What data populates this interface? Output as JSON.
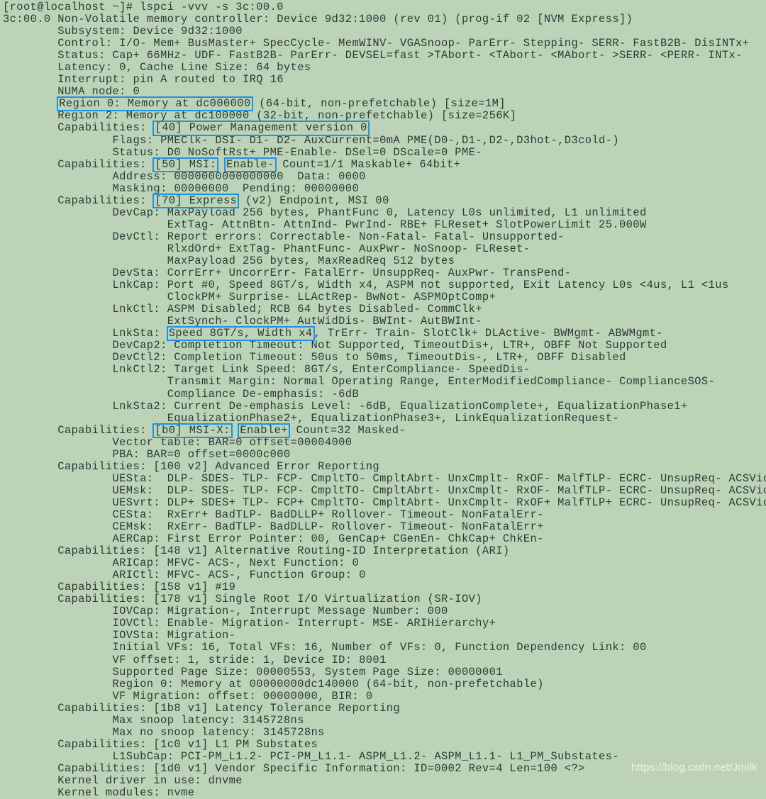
{
  "terminal": {
    "background_color": "#bdd3b8",
    "text_color": "#2b3a33",
    "highlight_color": "#1e93e6",
    "prompt": "[root@localhost ~]# ",
    "command": "lspci -vvv -s 3c:00.0",
    "watermark": "https://blog.csdn.net/Jmilk",
    "lines": [
      {
        "id": "l00",
        "segments": [
          {
            "text": "[root@localhost ~]# lspci -vvv -s 3c:00.0"
          }
        ]
      },
      {
        "id": "l01",
        "segments": [
          {
            "text": "3c:00.0 Non-Volatile memory controller: Device 9d32:1000 (rev 01) (prog-if 02 [NVM Express])"
          }
        ]
      },
      {
        "id": "l02",
        "segments": [
          {
            "text": "        Subsystem: Device 9d32:1000"
          }
        ]
      },
      {
        "id": "l03",
        "segments": [
          {
            "text": "        Control: I/O- Mem+ BusMaster+ SpecCycle- MemWINV- VGASnoop- ParErr- Stepping- SERR- FastB2B- DisINTx+"
          }
        ]
      },
      {
        "id": "l04",
        "segments": [
          {
            "text": "        Status: Cap+ 66MHz- UDF- FastB2B- ParErr- DEVSEL=fast >TAbort- <TAbort- <MAbort- >SERR- <PERR- INTx-"
          }
        ]
      },
      {
        "id": "l05",
        "segments": [
          {
            "text": "        Latency: 0, Cache Line Size: 64 bytes"
          }
        ]
      },
      {
        "id": "l06",
        "segments": [
          {
            "text": "        Interrupt: pin A routed to IRQ 16"
          }
        ]
      },
      {
        "id": "l07",
        "segments": [
          {
            "text": "        NUMA node: 0"
          }
        ]
      },
      {
        "id": "l08",
        "segments": [
          {
            "text": "        "
          },
          {
            "text": "Region 0: Memory at dc000000",
            "highlight": true
          },
          {
            "text": " (64-bit, non-prefetchable) [size=1M]"
          }
        ]
      },
      {
        "id": "l09",
        "segments": [
          {
            "text": "        Region 2: Memory at dc100000 (32-bit, non-prefetchable) [size=256K]"
          }
        ]
      },
      {
        "id": "l10",
        "segments": [
          {
            "text": "        Capabilities: "
          },
          {
            "text": "[40] Power Management version 0",
            "highlight": true
          }
        ]
      },
      {
        "id": "l11",
        "segments": [
          {
            "text": "                Flags: PMEClk- DSI- D1- D2- AuxCurrent=0mA PME(D0-,D1-,D2-,D3hot-,D3cold-)"
          }
        ]
      },
      {
        "id": "l12",
        "segments": [
          {
            "text": "                Status: D0 NoSoftRst+ PME-Enable- DSel=0 DScale=0 PME-"
          }
        ]
      },
      {
        "id": "l13",
        "segments": [
          {
            "text": "        Capabilities: "
          },
          {
            "text": "[50] MSI:",
            "highlight": true
          },
          {
            "text": " "
          },
          {
            "text": "Enable-",
            "highlight": true
          },
          {
            "text": " Count=1/1 Maskable+ 64bit+"
          }
        ]
      },
      {
        "id": "l14",
        "segments": [
          {
            "text": "                Address: 0000000000000000  Data: 0000"
          }
        ]
      },
      {
        "id": "l15",
        "segments": [
          {
            "text": "                Masking: 00000000  Pending: 00000000"
          }
        ]
      },
      {
        "id": "l16",
        "segments": [
          {
            "text": "        Capabilities: "
          },
          {
            "text": "[70] Express",
            "highlight": true
          },
          {
            "text": " (v2) Endpoint, MSI 00"
          }
        ]
      },
      {
        "id": "l17",
        "segments": [
          {
            "text": "                DevCap: MaxPayload 256 bytes, PhantFunc 0, Latency L0s unlimited, L1 unlimited"
          }
        ]
      },
      {
        "id": "l18",
        "segments": [
          {
            "text": "                        ExtTag- AttnBtn- AttnInd- PwrInd- RBE+ FLReset+ SlotPowerLimit 25.000W"
          }
        ]
      },
      {
        "id": "l19",
        "segments": [
          {
            "text": "                DevCtl: Report errors: Correctable- Non-Fatal- Fatal- Unsupported-"
          }
        ]
      },
      {
        "id": "l20",
        "segments": [
          {
            "text": "                        RlxdOrd+ ExtTag- PhantFunc- AuxPwr- NoSnoop- FLReset-"
          }
        ]
      },
      {
        "id": "l21",
        "segments": [
          {
            "text": "                        MaxPayload 256 bytes, MaxReadReq 512 bytes"
          }
        ]
      },
      {
        "id": "l22",
        "segments": [
          {
            "text": "                DevSta: CorrErr+ UncorrErr- FatalErr- UnsuppReq- AuxPwr- TransPend-"
          }
        ]
      },
      {
        "id": "l23",
        "segments": [
          {
            "text": "                LnkCap: Port #0, Speed 8GT/s, Width x4, ASPM not supported, Exit Latency L0s <4us, L1 <1us"
          }
        ]
      },
      {
        "id": "l24",
        "segments": [
          {
            "text": "                        ClockPM+ Surprise- LLActRep- BwNot- ASPMOptComp+"
          }
        ]
      },
      {
        "id": "l25",
        "segments": [
          {
            "text": "                LnkCtl: ASPM Disabled; RCB 64 bytes Disabled- CommClk+"
          }
        ]
      },
      {
        "id": "l26",
        "segments": [
          {
            "text": "                        ExtSynch- ClockPM+ AutWidDis- BWInt- AutBWInt-"
          }
        ]
      },
      {
        "id": "l27",
        "segments": [
          {
            "text": "                LnkSta: "
          },
          {
            "text": "Speed 8GT/s, Width x4",
            "highlight": true
          },
          {
            "text": ", TrErr- Train- SlotClk+ DLActive- BWMgmt- ABWMgmt-"
          }
        ]
      },
      {
        "id": "l28",
        "segments": [
          {
            "text": "                DevCap2: Completion Timeout: Not Supported, TimeoutDis+, LTR+, OBFF Not Supported"
          }
        ]
      },
      {
        "id": "l29",
        "segments": [
          {
            "text": "                DevCtl2: Completion Timeout: 50us to 50ms, TimeoutDis-, LTR+, OBFF Disabled"
          }
        ]
      },
      {
        "id": "l30",
        "segments": [
          {
            "text": "                LnkCtl2: Target Link Speed: 8GT/s, EnterCompliance- SpeedDis-"
          }
        ]
      },
      {
        "id": "l31",
        "segments": [
          {
            "text": "                        Transmit Margin: Normal Operating Range, EnterModifiedCompliance- ComplianceSOS-"
          }
        ]
      },
      {
        "id": "l32",
        "segments": [
          {
            "text": "                        Compliance De-emphasis: -6dB"
          }
        ]
      },
      {
        "id": "l33",
        "segments": [
          {
            "text": "                LnkSta2: Current De-emphasis Level: -6dB, EqualizationComplete+, EqualizationPhase1+"
          }
        ]
      },
      {
        "id": "l34",
        "segments": [
          {
            "text": "                        EqualizationPhase2+, EqualizationPhase3+, LinkEqualizationRequest-"
          }
        ]
      },
      {
        "id": "l35",
        "segments": [
          {
            "text": "        Capabilities: "
          },
          {
            "text": "[b0] MSI-X:",
            "highlight": true
          },
          {
            "text": " "
          },
          {
            "text": "Enable+",
            "highlight": true
          },
          {
            "text": " Count=32 Masked-"
          }
        ]
      },
      {
        "id": "l36",
        "segments": [
          {
            "text": "                Vector table: BAR=0 offset=00004000"
          }
        ]
      },
      {
        "id": "l37",
        "segments": [
          {
            "text": "                PBA: BAR=0 offset=0000c000"
          }
        ]
      },
      {
        "id": "l38",
        "segments": [
          {
            "text": "        Capabilities: [100 v2] Advanced Error Reporting"
          }
        ]
      },
      {
        "id": "l39",
        "segments": [
          {
            "text": "                UESta:  DLP- SDES- TLP- FCP- CmpltTO- CmpltAbrt- UnxCmplt- RxOF- MalfTLP- ECRC- UnsupReq- ACSViol-"
          }
        ]
      },
      {
        "id": "l40",
        "segments": [
          {
            "text": "                UEMsk:  DLP- SDES- TLP- FCP- CmpltTO- CmpltAbrt- UnxCmplt- RxOF- MalfTLP- ECRC- UnsupReq- ACSViol-"
          }
        ]
      },
      {
        "id": "l41",
        "segments": [
          {
            "text": "                UESvrt: DLP+ SDES+ TLP- FCP+ CmpltTO- CmpltAbrt- UnxCmplt- RxOF+ MalfTLP+ ECRC- UnsupReq- ACSViol-"
          }
        ]
      },
      {
        "id": "l42",
        "segments": [
          {
            "text": "                CESta:  RxErr+ BadTLP- BadDLLP+ Rollover- Timeout- NonFatalErr-"
          }
        ]
      },
      {
        "id": "l43",
        "segments": [
          {
            "text": "                CEMsk:  RxErr- BadTLP- BadDLLP- Rollover- Timeout- NonFatalErr+"
          }
        ]
      },
      {
        "id": "l44",
        "segments": [
          {
            "text": "                AERCap: First Error Pointer: 00, GenCap+ CGenEn- ChkCap+ ChkEn-"
          }
        ]
      },
      {
        "id": "l45",
        "segments": [
          {
            "text": "        Capabilities: [148 v1] Alternative Routing-ID Interpretation (ARI)"
          }
        ]
      },
      {
        "id": "l46",
        "segments": [
          {
            "text": "                ARICap: MFVC- ACS-, Next Function: 0"
          }
        ]
      },
      {
        "id": "l47",
        "segments": [
          {
            "text": "                ARICtl: MFVC- ACS-, Function Group: 0"
          }
        ]
      },
      {
        "id": "l48",
        "segments": [
          {
            "text": "        Capabilities: [158 v1] #19"
          }
        ]
      },
      {
        "id": "l49",
        "segments": [
          {
            "text": "        Capabilities: [178 v1] Single Root I/O Virtualization (SR-IOV)"
          }
        ]
      },
      {
        "id": "l50",
        "segments": [
          {
            "text": "                IOVCap: Migration-, Interrupt Message Number: 000"
          }
        ]
      },
      {
        "id": "l51",
        "segments": [
          {
            "text": "                IOVCtl: Enable- Migration- Interrupt- MSE- ARIHierarchy+"
          }
        ]
      },
      {
        "id": "l52",
        "segments": [
          {
            "text": "                IOVSta: Migration-"
          }
        ]
      },
      {
        "id": "l53",
        "segments": [
          {
            "text": "                Initial VFs: 16, Total VFs: 16, Number of VFs: 0, Function Dependency Link: 00"
          }
        ]
      },
      {
        "id": "l54",
        "segments": [
          {
            "text": "                VF offset: 1, stride: 1, Device ID: 8001"
          }
        ]
      },
      {
        "id": "l55",
        "segments": [
          {
            "text": "                Supported Page Size: 00000553, System Page Size: 00000001"
          }
        ]
      },
      {
        "id": "l56",
        "segments": [
          {
            "text": "                Region 0: Memory at 00000000dc140000 (64-bit, non-prefetchable)"
          }
        ]
      },
      {
        "id": "l57",
        "segments": [
          {
            "text": "                VF Migration: offset: 00000000, BIR: 0"
          }
        ]
      },
      {
        "id": "l58",
        "segments": [
          {
            "text": "        Capabilities: [1b8 v1] Latency Tolerance Reporting"
          }
        ]
      },
      {
        "id": "l59",
        "segments": [
          {
            "text": "                Max snoop latency: 3145728ns"
          }
        ]
      },
      {
        "id": "l60",
        "segments": [
          {
            "text": "                Max no snoop latency: 3145728ns"
          }
        ]
      },
      {
        "id": "l61",
        "segments": [
          {
            "text": "        Capabilities: [1c0 v1] L1 PM Substates"
          }
        ]
      },
      {
        "id": "l62",
        "segments": [
          {
            "text": "                L1SubCap: PCI-PM_L1.2- PCI-PM_L1.1- ASPM_L1.2- ASPM_L1.1- L1_PM_Substates-"
          }
        ]
      },
      {
        "id": "l63",
        "segments": [
          {
            "text": "        Capabilities: [1d0 v1] Vendor Specific Information: ID=0002 Rev=4 Len=100 <?>"
          }
        ]
      },
      {
        "id": "l64",
        "segments": [
          {
            "text": "        Kernel driver in use: dnvme"
          }
        ]
      },
      {
        "id": "l65",
        "segments": [
          {
            "text": "        Kernel modules: nvme"
          }
        ]
      }
    ]
  }
}
